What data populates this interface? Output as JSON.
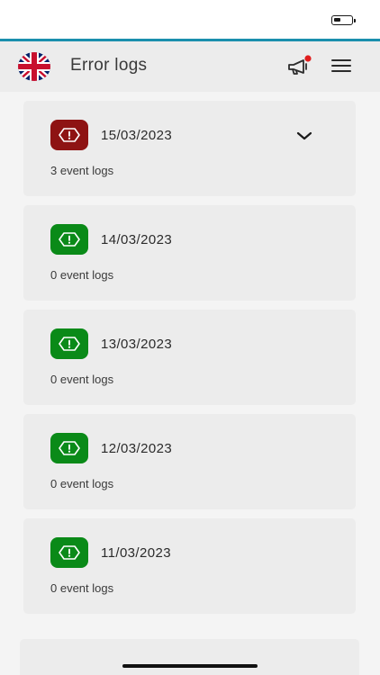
{
  "header": {
    "title": "Error logs",
    "language_icon": "uk-flag-icon",
    "notifications_icon": "megaphone-icon",
    "menu_icon": "hamburger-menu-icon"
  },
  "colors": {
    "accent": "#1a8fad",
    "error": "#8e1313",
    "ok": "#0a8a18",
    "notification_dot": "#e01e1e"
  },
  "logs": [
    {
      "date": "15/03/2023",
      "count_label": "3 event logs",
      "status": "error",
      "expanded_icon": "chevron-down-icon"
    },
    {
      "date": "14/03/2023",
      "count_label": "0 event logs",
      "status": "ok"
    },
    {
      "date": "13/03/2023",
      "count_label": "0 event logs",
      "status": "ok"
    },
    {
      "date": "12/03/2023",
      "count_label": "0 event logs",
      "status": "ok"
    },
    {
      "date": "11/03/2023",
      "count_label": "0 event logs",
      "status": "ok"
    }
  ]
}
